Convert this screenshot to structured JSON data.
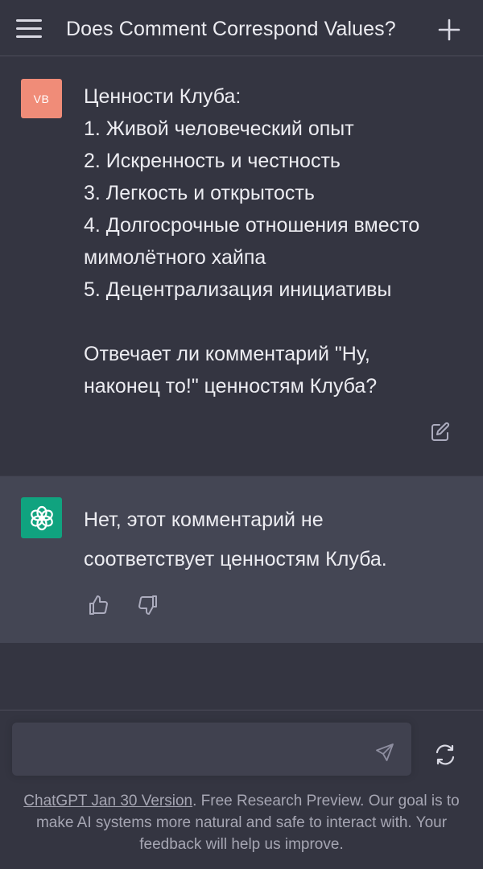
{
  "header": {
    "title": "Does Comment Correspond Values?",
    "menu_icon": "hamburger-menu-icon",
    "new_chat_icon": "plus-icon"
  },
  "user_message": {
    "avatar_initials": "VB",
    "avatar_color": "#f08c78",
    "lines": [
      "Ценности Клуба:",
      "1. Живой человеческий опыт",
      "2. Искренность и честность",
      "3. Легкость и открытость",
      "4. Долгосрочные отношения вместо",
      "мимолётного хайпа",
      "5. Децентрализация инициативы"
    ],
    "question_lines": [
      "Отвечает ли комментарий \"Ну,",
      "наконец то!\" ценностям Клуба?"
    ],
    "edit_icon": "edit-icon"
  },
  "assistant_message": {
    "avatar_color": "#10a37f",
    "avatar_icon": "openai-logo-icon",
    "lines": [
      "Нет, этот комментарий не",
      "соответствует ценностям Клуба."
    ],
    "thumbs_up_icon": "thumbs-up-icon",
    "thumbs_down_icon": "thumbs-down-icon"
  },
  "composer": {
    "value": "",
    "placeholder": "",
    "send_icon": "send-icon",
    "regenerate_icon": "regenerate-icon"
  },
  "footer": {
    "version_link": "ChatGPT Jan 30 Version",
    "text": ". Free Research Preview. Our goal is to make AI systems more natural and safe to interact with. Your feedback will help us improve."
  }
}
